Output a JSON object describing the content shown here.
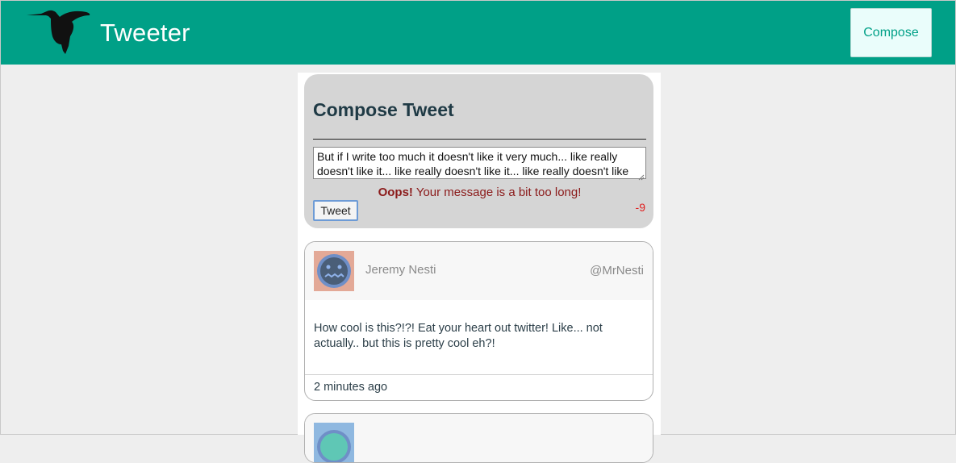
{
  "navbar": {
    "brand": "Tweeter",
    "compose_label": "Compose",
    "accent_color": "#00a087",
    "logo_icon": "hummingbird-icon"
  },
  "compose": {
    "title": "Compose Tweet",
    "input_value": "But if I write too much it doesn't like it very much... like really doesn't like it... like really doesn't like it... like really doesn't like it....",
    "error_prefix": "Oops!",
    "error_message": " Your message is a bit too long!",
    "submit_label": "Tweet",
    "counter": "-9"
  },
  "tweets": [
    {
      "name": "Jeremy Nesti",
      "handle": "@MrNesti",
      "text": "How cool is this?!?! Eat your heart out twitter! Like... not actually.. but this is pretty cool eh?!",
      "time": "2 minutes ago",
      "avatar_icon": "nervous-face-avatar-icon"
    },
    {
      "avatar_icon": "face-avatar-icon"
    }
  ]
}
